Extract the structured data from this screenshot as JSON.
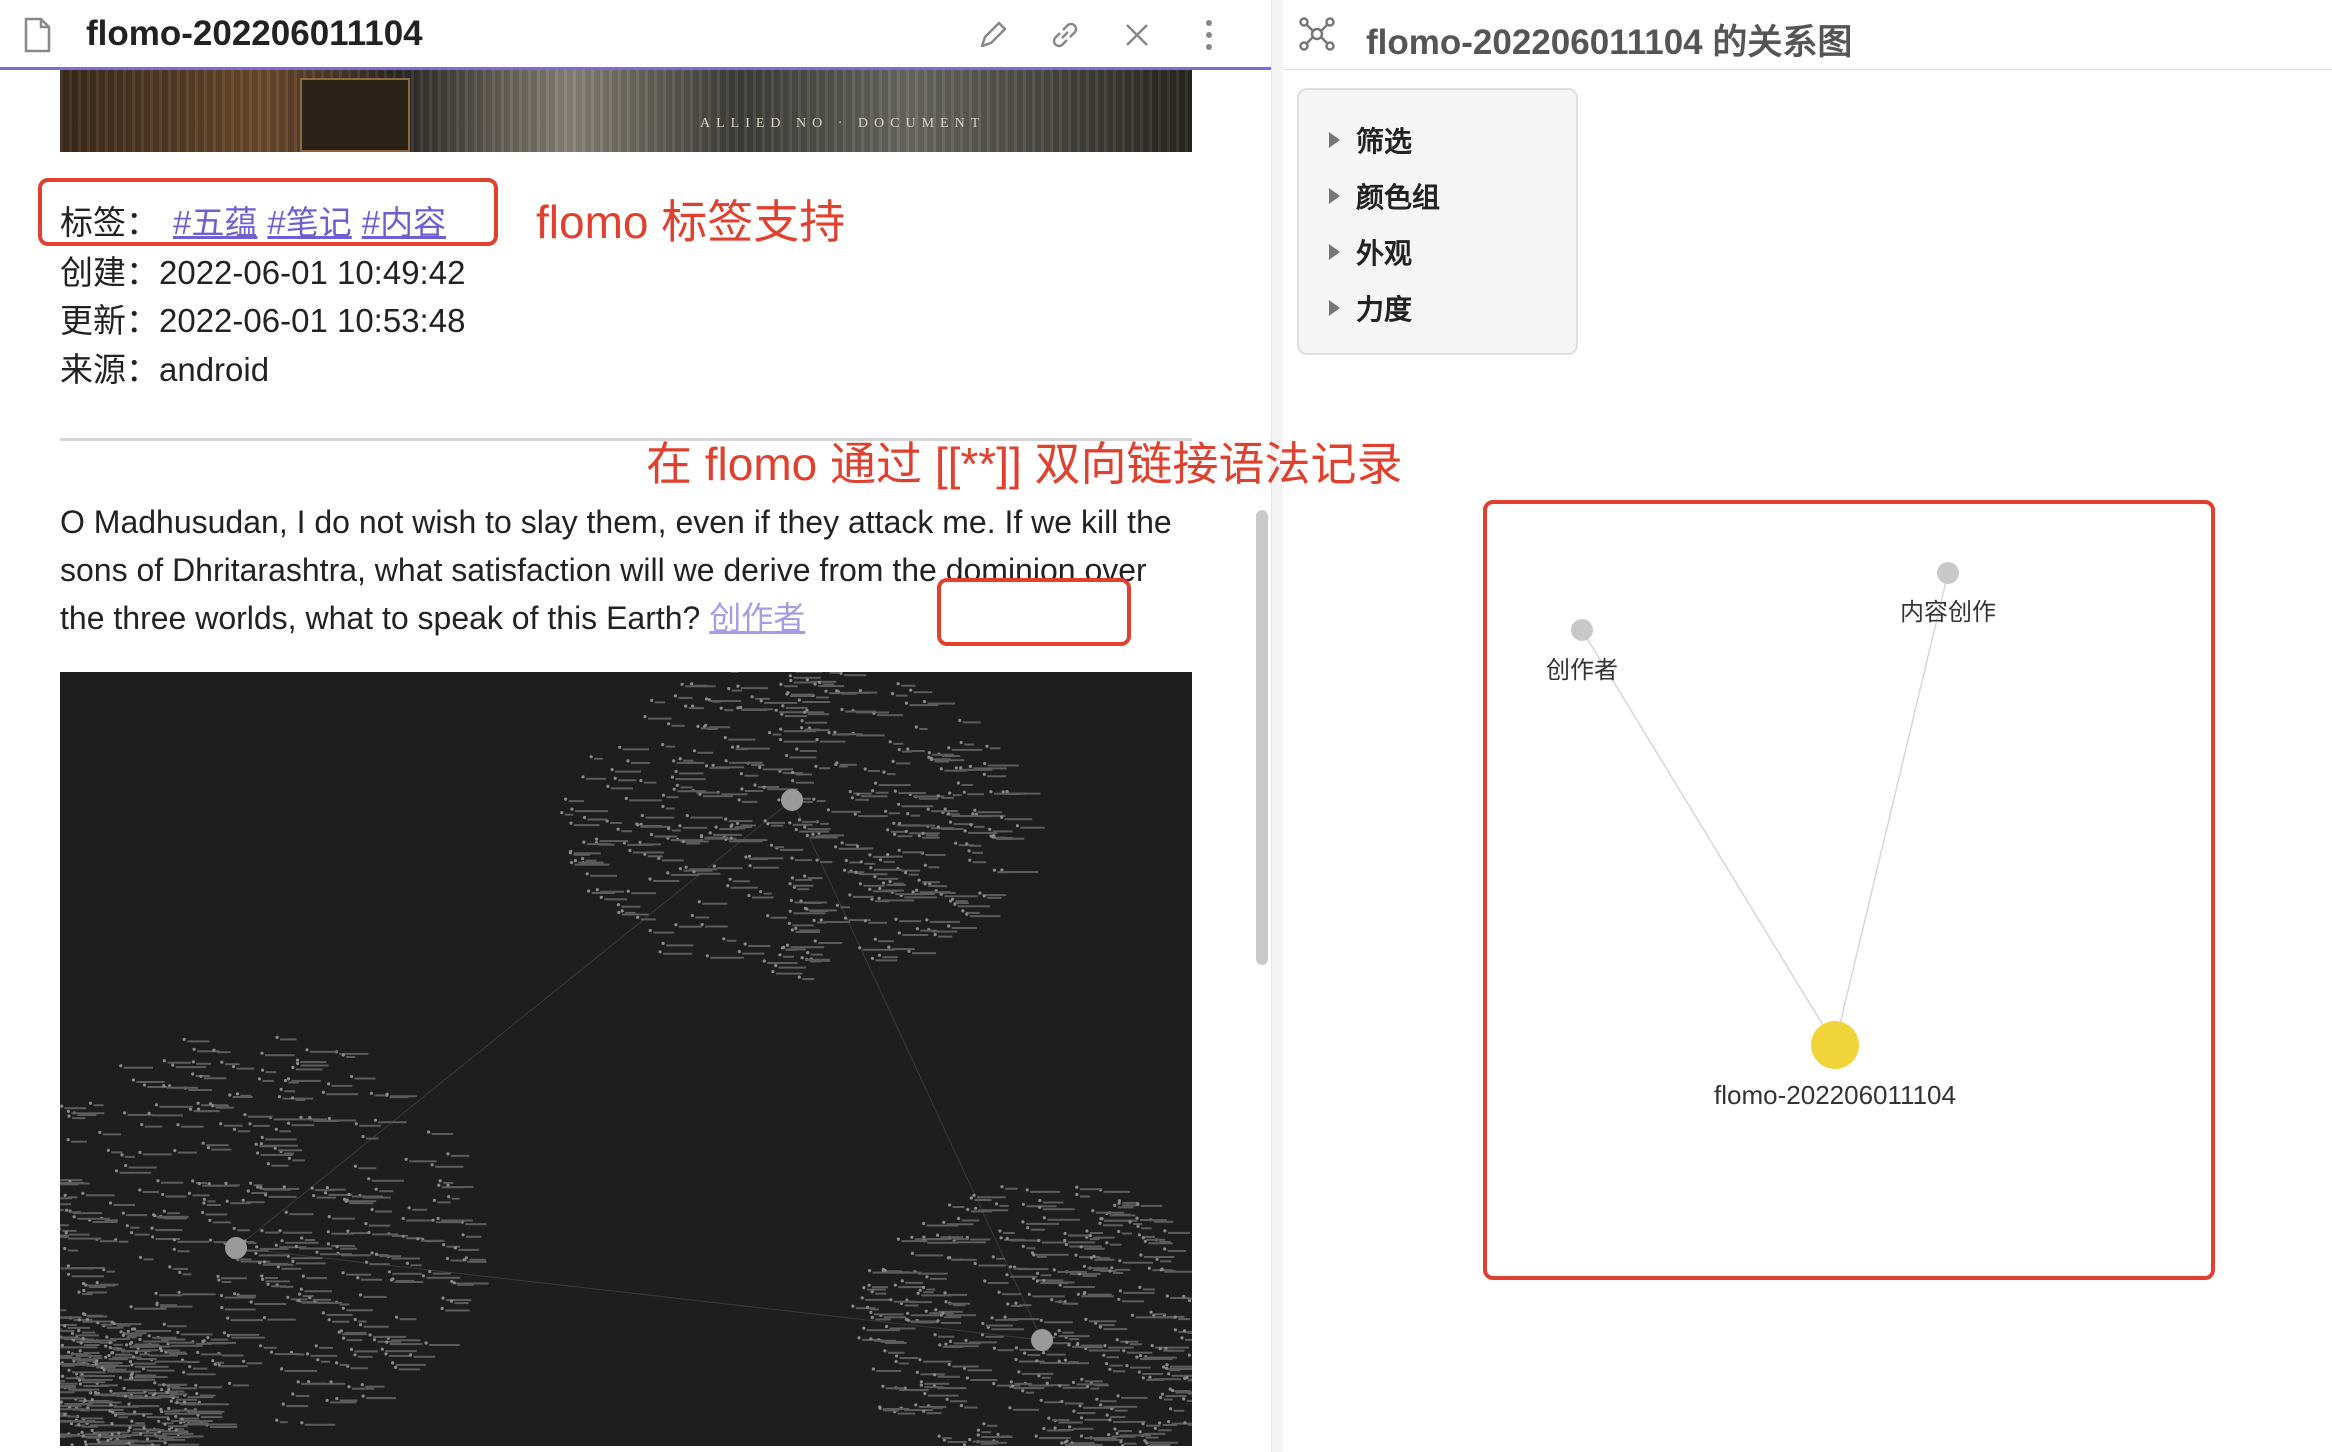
{
  "left_pane": {
    "title": "flomo-202206011104",
    "banner_text": "ALLIED NO · DOCUMENT",
    "tags_label": "标签：",
    "tags": [
      "#五蕴",
      "#笔记",
      "#内容"
    ],
    "created": "创建：2022-06-01 10:49:42",
    "updated": "更新：2022-06-01 10:53:48",
    "source": "来源：android",
    "paragraph": "O Madhusudan, I do not wish to slay them, even if they attack me. If we kill the sons of Dhritarashtra, what satisfaction will we derive from the dominion over the three worlds, what to speak of this Earth? ",
    "paragraph_link": "创作者"
  },
  "annotations": {
    "tag_support": "flomo 标签支持",
    "link_syntax": "在 flomo 通过 [[**]] 双向链接语法记录"
  },
  "right_pane": {
    "title": "flomo-202206011104 的关系图",
    "controls": [
      "筛选",
      "颜色组",
      "外观",
      "力度"
    ],
    "graph": {
      "nodes": [
        {
          "label": "创作者",
          "color": "#c8c8c8"
        },
        {
          "label": "内容创作",
          "color": "#c8c8c8"
        },
        {
          "label": "flomo-202206011104",
          "color": "#f1d33a"
        }
      ]
    }
  },
  "colors": {
    "accent": "#7b6cd9",
    "annotation_red": "#e0412f",
    "tag_link": "#6d5fd0",
    "active_node": "#f1d33a"
  }
}
